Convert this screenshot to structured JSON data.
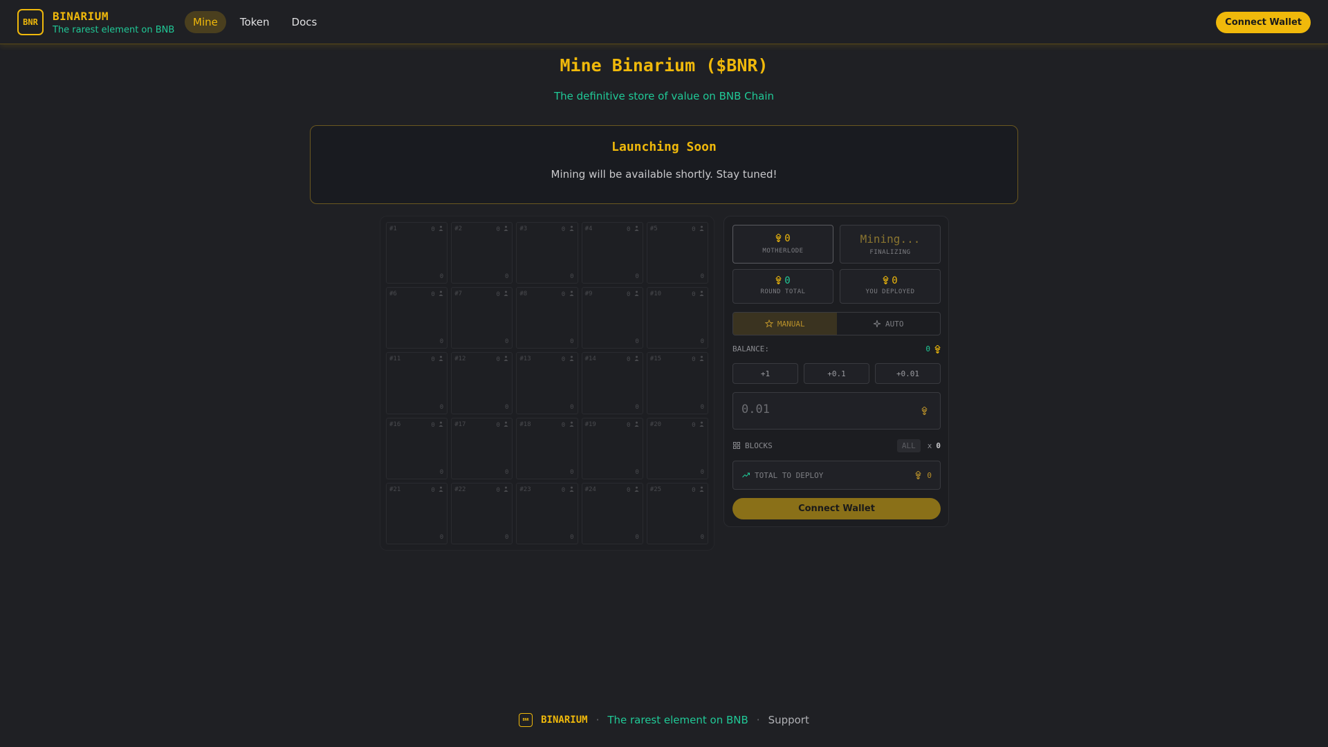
{
  "header": {
    "logo_text": "BNR",
    "brand_name": "BINARIUM",
    "tagline": "The rarest element on BNB",
    "nav": [
      "Mine",
      "Token",
      "Docs"
    ],
    "connect_label": "Connect Wallet"
  },
  "page": {
    "title": "Mine Binarium ($BNR)",
    "subtitle": "The definitive store of value on BNB Chain"
  },
  "launch": {
    "title": "Launching Soon",
    "text": "Mining will be available shortly. Stay tuned!"
  },
  "grid": {
    "cells": [
      {
        "num": "#1",
        "miners": "0",
        "value": "0"
      },
      {
        "num": "#2",
        "miners": "0",
        "value": "0"
      },
      {
        "num": "#3",
        "miners": "0",
        "value": "0"
      },
      {
        "num": "#4",
        "miners": "0",
        "value": "0"
      },
      {
        "num": "#5",
        "miners": "0",
        "value": "0"
      },
      {
        "num": "#6",
        "miners": "0",
        "value": "0"
      },
      {
        "num": "#7",
        "miners": "0",
        "value": "0"
      },
      {
        "num": "#8",
        "miners": "0",
        "value": "0"
      },
      {
        "num": "#9",
        "miners": "0",
        "value": "0"
      },
      {
        "num": "#10",
        "miners": "0",
        "value": "0"
      },
      {
        "num": "#11",
        "miners": "0",
        "value": "0"
      },
      {
        "num": "#12",
        "miners": "0",
        "value": "0"
      },
      {
        "num": "#13",
        "miners": "0",
        "value": "0"
      },
      {
        "num": "#14",
        "miners": "0",
        "value": "0"
      },
      {
        "num": "#15",
        "miners": "0",
        "value": "0"
      },
      {
        "num": "#16",
        "miners": "0",
        "value": "0"
      },
      {
        "num": "#17",
        "miners": "0",
        "value": "0"
      },
      {
        "num": "#18",
        "miners": "0",
        "value": "0"
      },
      {
        "num": "#19",
        "miners": "0",
        "value": "0"
      },
      {
        "num": "#20",
        "miners": "0",
        "value": "0"
      },
      {
        "num": "#21",
        "miners": "0",
        "value": "0"
      },
      {
        "num": "#22",
        "miners": "0",
        "value": "0"
      },
      {
        "num": "#23",
        "miners": "0",
        "value": "0"
      },
      {
        "num": "#24",
        "miners": "0",
        "value": "0"
      },
      {
        "num": "#25",
        "miners": "0",
        "value": "0"
      }
    ]
  },
  "stats": {
    "motherlode_value": "0",
    "motherlode_label": "MOTHERLODE",
    "mining_value": "Mining...",
    "mining_label": "FINALIZING",
    "round_total_value": "0",
    "round_total_label": "ROUND TOTAL",
    "deployed_value": "0",
    "deployed_label": "YOU DEPLOYED"
  },
  "mode": {
    "manual": "MANUAL",
    "auto": "AUTO"
  },
  "balance": {
    "label": "BALANCE:",
    "value": "0"
  },
  "increments": [
    "+1",
    "+0.1",
    "+0.01"
  ],
  "amount": {
    "placeholder": "0.01"
  },
  "blocks": {
    "label": "BLOCKS",
    "all_label": "ALL",
    "x": "x",
    "count": "0"
  },
  "total": {
    "label": "TOTAL TO DEPLOY",
    "value": "0"
  },
  "action": {
    "connect_label": "Connect Wallet"
  },
  "footer": {
    "logo_text": "BNR",
    "brand": "BINARIUM",
    "sep": "·",
    "tagline": "The rarest element on BNB",
    "support": "Support"
  },
  "colors": {
    "accent": "#f0b90b",
    "teal": "#20c997",
    "background": "#1f2024"
  }
}
